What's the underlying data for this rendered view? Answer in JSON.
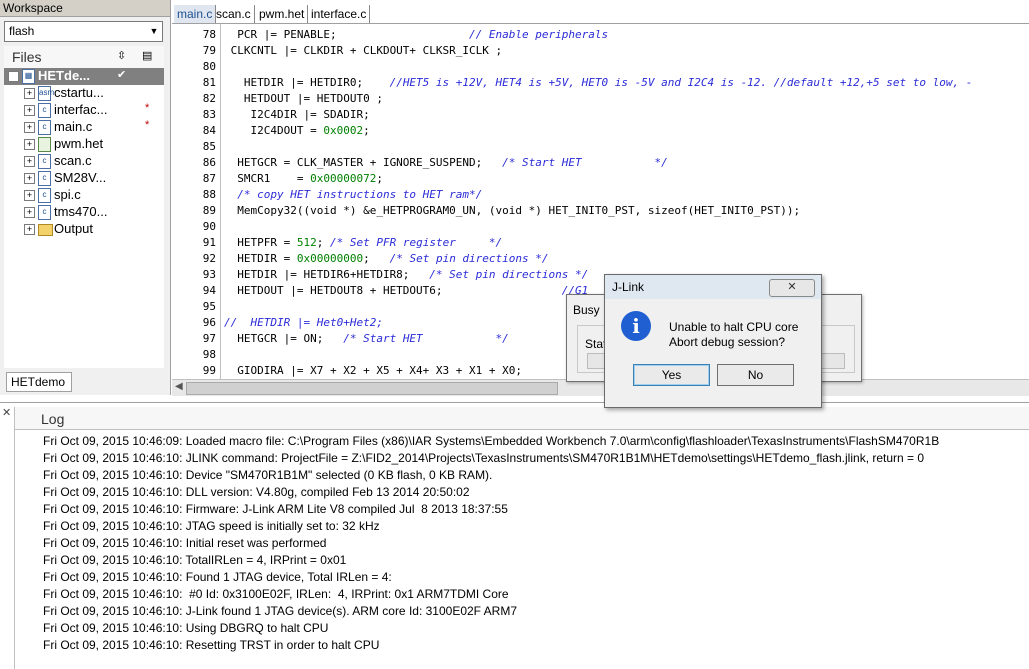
{
  "workspace": {
    "title": "Workspace",
    "config": "flash",
    "files_label": "Files",
    "tab": "HETdemo",
    "tree": [
      {
        "name": "HETde...",
        "icon": "project",
        "mark": "✔"
      },
      {
        "name": "cstartu...",
        "icon": "asm",
        "mark": ""
      },
      {
        "name": "interfac...",
        "icon": "c",
        "mark": "*"
      },
      {
        "name": "main.c",
        "icon": "c",
        "mark": "*"
      },
      {
        "name": "pwm.het",
        "icon": "het",
        "mark": ""
      },
      {
        "name": "scan.c",
        "icon": "c",
        "mark": ""
      },
      {
        "name": "SM28V...",
        "icon": "c",
        "mark": ""
      },
      {
        "name": "spi.c",
        "icon": "c",
        "mark": ""
      },
      {
        "name": "tms470...",
        "icon": "c",
        "mark": ""
      },
      {
        "name": "Output",
        "icon": "folder",
        "mark": ""
      }
    ]
  },
  "editor": {
    "tabs": [
      "main.c",
      "scan.c",
      "pwm.het",
      "interface.c"
    ],
    "lines": [
      {
        "n": "78",
        "code": "  PCR |= PENABLE;",
        "comment": "                    // Enable peripherals"
      },
      {
        "n": "79",
        "code": " CLKCNTL |= CLKDIR + CLKDOUT+ CLKSR_ICLK ;",
        "comment": ""
      },
      {
        "n": "80",
        "code": "",
        "comment": ""
      },
      {
        "n": "81",
        "code": "   HETDIR |= HETDIR0;",
        "comment": "    //HET5 is +12V, HET4 is +5V, HET0 is -5V and I2C4 is -12. //default +12,+5 set to low, -"
      },
      {
        "n": "82",
        "code": "   HETDOUT |= HETDOUT0 ;",
        "comment": ""
      },
      {
        "n": "83",
        "code": "    I2C4DIR |= SDADIR;",
        "comment": ""
      },
      {
        "n": "84",
        "code": "    I2C4DOUT = 0x0002;",
        "comment": ""
      },
      {
        "n": "85",
        "code": "",
        "comment": ""
      },
      {
        "n": "86",
        "code": "  HETGCR = CLK_MASTER + IGNORE_SUSPEND;",
        "comment": "   /* Start HET           */"
      },
      {
        "n": "87",
        "code": "  SMCR1    = 0x00000072;",
        "comment": ""
      },
      {
        "n": "88",
        "code": "",
        "comment": "  /* copy HET instructions to HET ram*/"
      },
      {
        "n": "89",
        "code": "  MemCopy32((void *) &e_HETPROGRAM0_UN, (void *) HET_INIT0_PST, sizeof(HET_INIT0_PST));",
        "comment": ""
      },
      {
        "n": "90",
        "code": "",
        "comment": ""
      },
      {
        "n": "91",
        "code": "  HETPFR = 512;",
        "comment": " /* Set PFR register     */"
      },
      {
        "n": "92",
        "code": "  HETDIR = 0x00000000;",
        "comment": "   /* Set pin directions */"
      },
      {
        "n": "93",
        "code": "  HETDIR |= HETDIR6+HETDIR8;",
        "comment": "   /* Set pin directions */"
      },
      {
        "n": "94",
        "code": "  HETDOUT |= HETDOUT8 + HETDOUT6;",
        "comment": "                  //G1"
      },
      {
        "n": "95",
        "code": "",
        "comment": ""
      },
      {
        "n": "96",
        "code": "",
        "comment": "//  HETDIR |= Het0+Het2;"
      },
      {
        "n": "97",
        "code": "  HETGCR |= ON;",
        "comment": "   /* Start HET           */"
      },
      {
        "n": "98",
        "code": "",
        "comment": ""
      },
      {
        "n": "99",
        "code": "  GIODIRA |= X7 + X2 + X5 + X4+ X3 + X1 + X0;",
        "comment": ""
      }
    ]
  },
  "log": {
    "title": "Log",
    "lines": [
      "Fri Oct 09, 2015 10:46:09: Loaded macro file: C:\\Program Files (x86)\\IAR Systems\\Embedded Workbench 7.0\\arm\\config\\flashloader\\TexasInstruments\\FlashSM470R1B",
      "Fri Oct 09, 2015 10:46:10: JLINK command: ProjectFile = Z:\\FID2_2014\\Projects\\TexasInstruments\\SM470R1B1M\\HETdemo\\settings\\HETdemo_flash.jlink, return = 0",
      "Fri Oct 09, 2015 10:46:10: Device \"SM470R1B1M\" selected (0 KB flash, 0 KB RAM).",
      "Fri Oct 09, 2015 10:46:10: DLL version: V4.80g, compiled Feb 13 2014 20:50:02",
      "Fri Oct 09, 2015 10:46:10: Firmware: J-Link ARM Lite V8 compiled Jul  8 2013 18:37:55",
      "Fri Oct 09, 2015 10:46:10: JTAG speed is initially set to: 32 kHz",
      "Fri Oct 09, 2015 10:46:10: Initial reset was performed",
      "Fri Oct 09, 2015 10:46:10: TotalIRLen = 4, IRPrint = 0x01",
      "Fri Oct 09, 2015 10:46:10: Found 1 JTAG device, Total IRLen = 4:",
      "Fri Oct 09, 2015 10:46:10:  #0 Id: 0x3100E02F, IRLen:  4, IRPrint: 0x1 ARM7TDMI Core",
      "Fri Oct 09, 2015 10:46:10: J-Link found 1 JTAG device(s). ARM core Id: 3100E02F ARM7",
      "Fri Oct 09, 2015 10:46:10: Using DBGRQ to halt CPU",
      "Fri Oct 09, 2015 10:46:10: Resetting TRST in order to halt CPU"
    ]
  },
  "busy_dialog": {
    "title": "Busy",
    "status_label": "Stat"
  },
  "jlink_dialog": {
    "title": "J-Link",
    "close_label": "✕",
    "message_line1": "Unable to halt CPU core",
    "message_line2": "Abort debug session?",
    "yes_label": "Yes",
    "no_label": "No"
  }
}
